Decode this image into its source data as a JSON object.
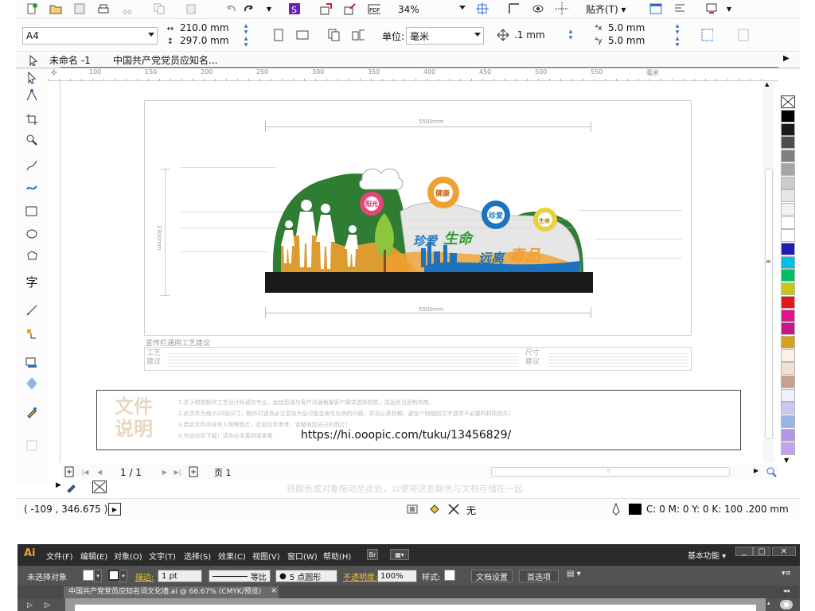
{
  "corel": {
    "toolbar1": {
      "zoom": "34%",
      "snap_label": "贴齐(T)"
    },
    "propbar": {
      "page_size": "A4",
      "width": "210.0 mm",
      "height": "297.0 mm",
      "units_label": "单位:",
      "units_value": "毫米",
      "nudge": ".1 mm",
      "dup_x": "5.0 mm",
      "dup_y": "5.0 mm"
    },
    "tabs": [
      "未命名 -1",
      "中国共产党党员应知名..."
    ],
    "ruler_ticks": [
      "100",
      "150",
      "200",
      "250",
      "300",
      "350",
      "400",
      "450",
      "500",
      "550",
      "毫米"
    ],
    "design": {
      "dim_top": "5500mm",
      "dim_bottom": "5500mm",
      "dim_side": "2300mm",
      "flower_sun": "阳光",
      "flower_health": "健康",
      "flower_love": "珍爱",
      "flower_life": "生命",
      "slogan1a": "珍爱",
      "slogan1b": "生命",
      "slogan2a": "远离",
      "slogan2b": "毒品",
      "craft_title": "宣传栏通用工艺建议",
      "craft_label": "工艺建议",
      "size_label": "尺寸建议"
    },
    "notes": {
      "title": "文件说明",
      "line1": "1.关于材质制作工艺设计师请勿专业，会给您请与客户沟通根据客户需求选择材质，成品尚当思制作商。",
      "line2": "2.此文件为缩小10倍尺寸，制作时请务必注意放大后可能会发生比例的问题，并充认真校稿，避免个别细则文字选项不必要的材质损失！",
      "line3": "3.若此文件中含有人物等图片，此处仅供参考，请替换您自己的图片！",
      "line4": "4.作品仅供下载！请务必本素材请查看",
      "url": "https://hi.ooopic.com/tuku/13456829/"
    },
    "pagebar": {
      "counter": "1 / 1",
      "page_tab": "页 1"
    },
    "hint": "将颜色或对象拖动至此处，以便将这些颜色与文档存储在一起",
    "status": {
      "coords": "( -109 , 346.675 )",
      "fill_none": "无",
      "outline": "C: 0 M: 0 Y: 0 K: 100  .200 mm"
    },
    "palette": [
      "#000000",
      "#1a1a1a",
      "#4d4d4d",
      "#808080",
      "#a6a6a6",
      "#cccccc",
      "#e6e6e6",
      "#f2f2f2",
      "#ffffff",
      "#ffffff",
      "#1d1db5",
      "#00bfe6",
      "#00c060",
      "#c8c814",
      "#e01a1a",
      "#e0148c",
      "#c8148c",
      "#d8a01e",
      "#fff0e6",
      "#f0e1d2",
      "#c8a08c",
      "#f0f0fa",
      "#c8c8f0",
      "#96b4e6",
      "#b496e6",
      "#c8a0f0"
    ]
  },
  "ai": {
    "logo": "Ai",
    "menu": [
      "文件(F)",
      "编辑(E)",
      "对象(O)",
      "文字(T)",
      "选择(S)",
      "效果(C)",
      "视图(V)",
      "窗口(W)",
      "帮助(H)"
    ],
    "workspace": "基本功能",
    "ctrl": {
      "no_selection": "未选择对象",
      "stroke_label": "描边:",
      "stroke_value": "1 pt",
      "line_style": "等比",
      "brush": "5 点圆形",
      "opacity_label": "不透明度:",
      "opacity_value": "100%",
      "style_label": "样式:",
      "doc_settings": "文档设置",
      "preferences": "首选项"
    },
    "tab_title": "中国共产党党员应知名词文化墙.ai @ 66.67% (CMYK/预览)",
    "tab_close": "×"
  }
}
